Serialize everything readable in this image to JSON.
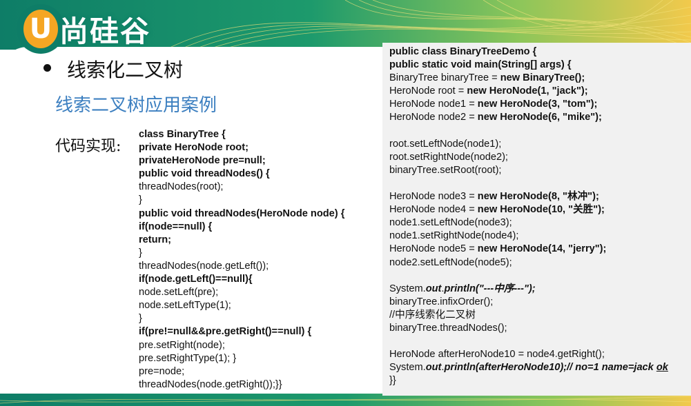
{
  "brand": {
    "logo_letter": "U",
    "logo_text": "尚硅谷"
  },
  "heading": "线索化二叉树",
  "subheading": "线索二叉树应用案例",
  "code_label": "代码实现:",
  "left_code": [
    [
      {
        "t": "class BinaryTree {",
        "s": "b"
      }
    ],
    [
      {
        "t": "private HeroNode root;",
        "s": "b"
      }
    ],
    [
      {
        "t": "privateHeroNode pre=null;",
        "s": "b"
      }
    ],
    [
      {
        "t": "public void threadNodes() {",
        "s": "b"
      }
    ],
    [
      {
        "t": "threadNodes(root);",
        "s": ""
      }
    ],
    [
      {
        "t": "}",
        "s": ""
      }
    ],
    [
      {
        "t": "public void threadNodes(HeroNode node) {",
        "s": "b"
      }
    ],
    [
      {
        "t": "if(node==null) {",
        "s": "b"
      }
    ],
    [
      {
        "t": "return;",
        "s": "b"
      }
    ],
    [
      {
        "t": "}",
        "s": ""
      }
    ],
    [
      {
        "t": "threadNodes(node.getLeft());",
        "s": ""
      }
    ],
    [
      {
        "t": "if(node.getLeft()==null){",
        "s": "b"
      }
    ],
    [
      {
        "t": "node.setLeft(pre);",
        "s": ""
      }
    ],
    [
      {
        "t": "node.setLeftType(1);",
        "s": ""
      }
    ],
    [
      {
        "t": "}",
        "s": ""
      }
    ],
    [
      {
        "t": "if(pre!=null&&pre.getRight()==null) {",
        "s": "b"
      }
    ],
    [
      {
        "t": "pre.setRight(node);",
        "s": ""
      }
    ],
    [
      {
        "t": "pre.setRightType(1); }",
        "s": ""
      }
    ],
    [
      {
        "t": "pre=node;",
        "s": ""
      }
    ],
    [
      {
        "t": "threadNodes(node.getRight());}}",
        "s": ""
      }
    ]
  ],
  "right_code": [
    [
      {
        "t": "public class BinaryTreeDemo {",
        "s": "b"
      }
    ],
    [
      {
        "t": "public static void main(String[] args) {",
        "s": "b"
      }
    ],
    [
      {
        "t": "BinaryTree binaryTree = ",
        "s": ""
      },
      {
        "t": "new BinaryTree();",
        "s": "b"
      }
    ],
    [
      {
        "t": "HeroNode root = ",
        "s": ""
      },
      {
        "t": "new HeroNode(1, \"jack\");",
        "s": "b"
      }
    ],
    [
      {
        "t": "HeroNode node1 = ",
        "s": ""
      },
      {
        "t": "new HeroNode(3, \"tom\");",
        "s": "b"
      }
    ],
    [
      {
        "t": "HeroNode node2 = ",
        "s": ""
      },
      {
        "t": "new HeroNode(6, \"mike\");",
        "s": "b"
      }
    ],
    [],
    [
      {
        "t": "root.setLeftNode(node1);",
        "s": ""
      }
    ],
    [
      {
        "t": "root.setRightNode(node2);",
        "s": ""
      }
    ],
    [
      {
        "t": "binaryTree.setRoot(root);",
        "s": ""
      }
    ],
    [],
    [
      {
        "t": "HeroNode node3 = ",
        "s": ""
      },
      {
        "t": "new HeroNode(8, \"林冲\");",
        "s": "b"
      }
    ],
    [
      {
        "t": "HeroNode node4 = ",
        "s": ""
      },
      {
        "t": "new HeroNode(10, \"关胜\");",
        "s": "b"
      }
    ],
    [
      {
        "t": "node1.setLeftNode(node3);",
        "s": ""
      }
    ],
    [
      {
        "t": "node1.setRightNode(node4);",
        "s": ""
      }
    ],
    [
      {
        "t": "HeroNode node5 = ",
        "s": ""
      },
      {
        "t": "new HeroNode(14, \"jerry\");",
        "s": "b"
      }
    ],
    [
      {
        "t": "node2.setLeftNode(node5);",
        "s": ""
      }
    ],
    [],
    [
      {
        "t": "System.",
        "s": ""
      },
      {
        "t": "out",
        "s": "bi"
      },
      {
        "t": ".",
        "s": ""
      },
      {
        "t": "println(\"---中序---\");",
        "s": "bi"
      }
    ],
    [
      {
        "t": "binaryTree.infixOrder();",
        "s": ""
      }
    ],
    [
      {
        "t": "//中序线索化二叉树",
        "s": ""
      }
    ],
    [
      {
        "t": "binaryTree.threadNodes();",
        "s": ""
      }
    ],
    [],
    [
      {
        "t": "HeroNode afterHeroNode10 = node4.getRight();",
        "s": ""
      }
    ],
    [
      {
        "t": "System.",
        "s": ""
      },
      {
        "t": "out",
        "s": "bi"
      },
      {
        "t": ".",
        "s": ""
      },
      {
        "t": "println(afterHeroNode10);// no=1 name=jack ",
        "s": "bi"
      },
      {
        "t": "ok",
        "s": "bi u"
      }
    ],
    [
      {
        "t": "}}",
        "s": ""
      }
    ]
  ]
}
